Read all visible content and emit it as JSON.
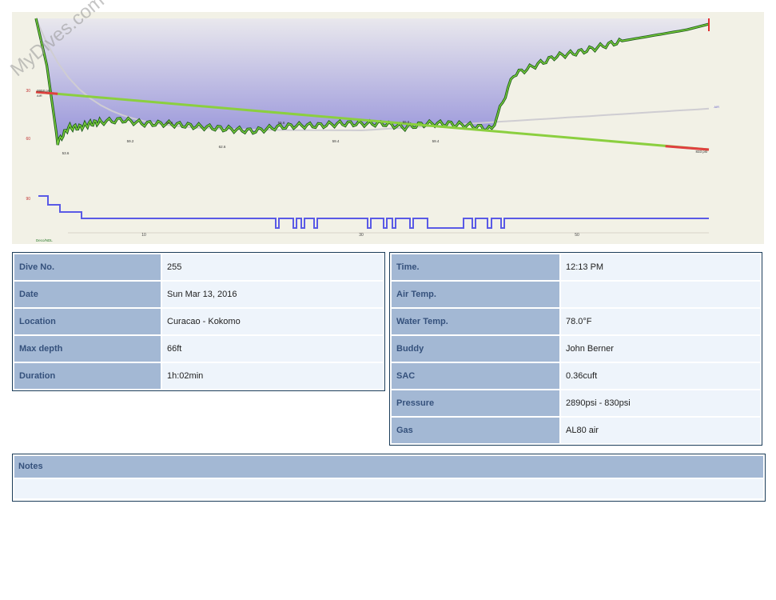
{
  "watermark": "MyDives.com",
  "chart_data": {
    "type": "line",
    "x_unit": "min",
    "x_ticks": [
      10,
      30,
      50
    ],
    "depth_ticks": [
      30,
      60,
      90
    ],
    "depth_labels": [
      "53.6",
      "59.2",
      "62.6",
      "59.4",
      "59.4",
      "55.6",
      "55.6",
      "55.6"
    ],
    "pressure_start_label": "2958 psi",
    "pressure_end_label": "833 psi",
    "gas_label": "AIR",
    "ndl_label": "Deco/NDL",
    "series": [
      {
        "name": "Depth (ft)",
        "x": [
          0,
          1,
          2,
          3,
          4,
          5,
          6,
          8,
          10,
          12,
          14,
          16,
          18,
          20,
          22,
          24,
          26,
          28,
          30,
          32,
          34,
          36,
          38,
          40,
          42,
          44,
          46,
          48,
          50,
          52,
          54,
          56,
          58,
          60,
          62
        ],
        "values": [
          0,
          25,
          66,
          58,
          58,
          56,
          55,
          54,
          56,
          56,
          57,
          58,
          59,
          60,
          58,
          57,
          57,
          56,
          56,
          56,
          58,
          56,
          56,
          57,
          59,
          30,
          25,
          20,
          18,
          15,
          12,
          10,
          8,
          6,
          3
        ]
      },
      {
        "name": "Pressure (psi)",
        "x": [
          0,
          62
        ],
        "values": [
          2958,
          833
        ]
      }
    ]
  },
  "left": {
    "rows": [
      {
        "label": "Dive No.",
        "value": "255"
      },
      {
        "label": "Date",
        "value": "Sun Mar 13, 2016"
      },
      {
        "label": "Location",
        "value": "Curacao - Kokomo"
      },
      {
        "label": "Max depth",
        "value": "66ft"
      },
      {
        "label": "Duration",
        "value": "1h:02min"
      }
    ]
  },
  "right": {
    "rows": [
      {
        "label": "Time.",
        "value": "12:13 PM"
      },
      {
        "label": "Air Temp.",
        "value": ""
      },
      {
        "label": "Water Temp.",
        "value": "78.0°F"
      },
      {
        "label": "Buddy",
        "value": "John Berner"
      },
      {
        "label": "SAC",
        "value": "0.36cuft"
      },
      {
        "label": "Pressure",
        "value": "2890psi - 830psi"
      },
      {
        "label": "Gas",
        "value": "AL80 air"
      }
    ]
  },
  "notes": {
    "label": "Notes",
    "value": ""
  }
}
